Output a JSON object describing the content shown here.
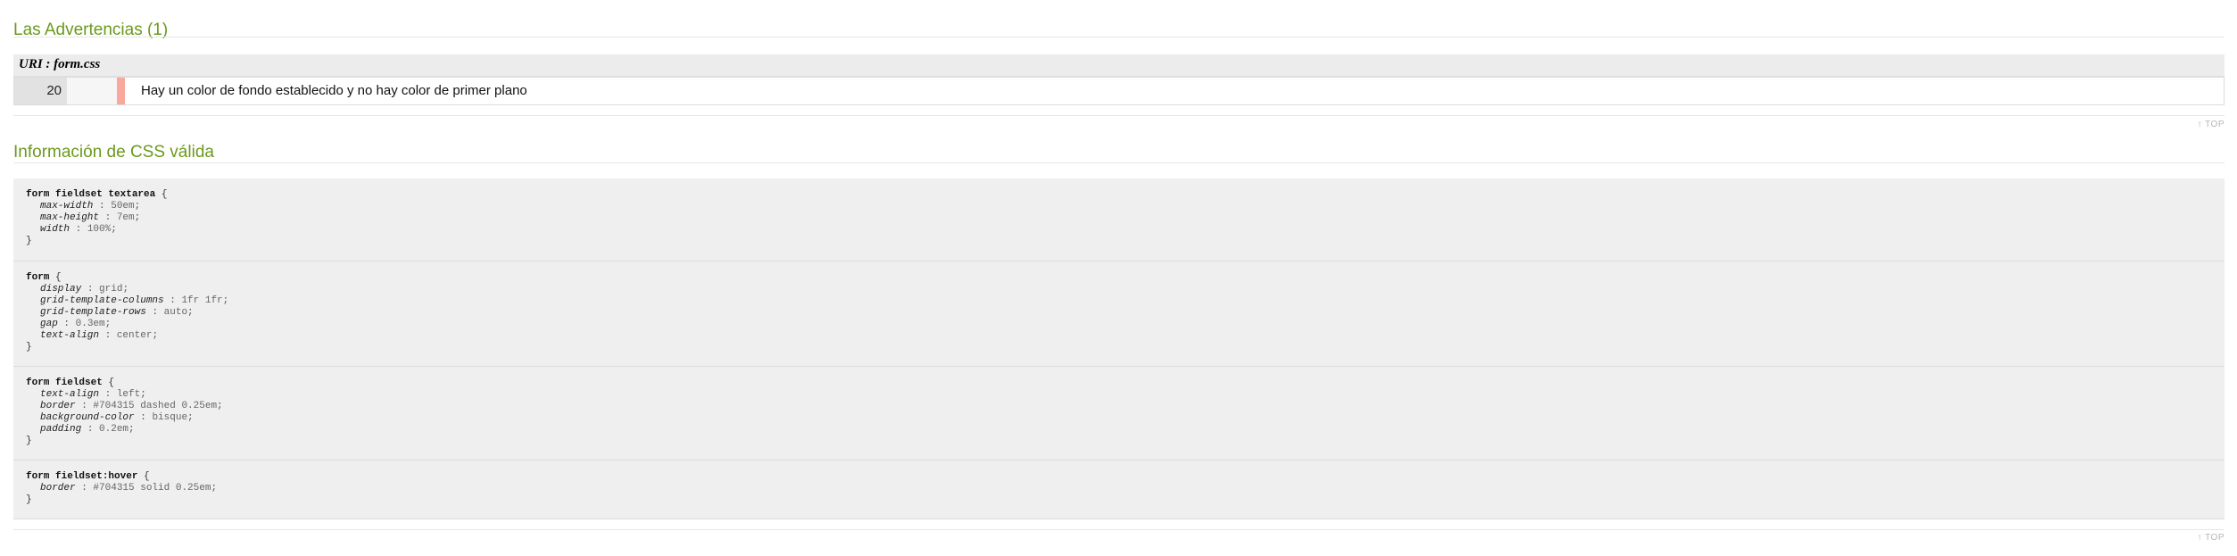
{
  "nav": {
    "top_label": "↑ TOP"
  },
  "warnings": {
    "title": "Las Advertencias (1)",
    "uri_label": "URI : form.css",
    "items": [
      {
        "line": "20",
        "message": "Hay un color de fondo establecido y no hay color de primer plano"
      }
    ]
  },
  "valid_css": {
    "title": "Información de CSS válida",
    "rules": [
      {
        "selector": "form fieldset textarea",
        "declarations": [
          {
            "property": "max-width",
            "value": "50em"
          },
          {
            "property": "max-height",
            "value": "7em"
          },
          {
            "property": "width",
            "value": "100%"
          }
        ]
      },
      {
        "selector": "form",
        "declarations": [
          {
            "property": "display",
            "value": "grid"
          },
          {
            "property": "grid-template-columns",
            "value": "1fr 1fr"
          },
          {
            "property": "grid-template-rows",
            "value": "auto"
          },
          {
            "property": "gap",
            "value": "0.3em"
          },
          {
            "property": "text-align",
            "value": "center"
          }
        ]
      },
      {
        "selector": "form fieldset",
        "declarations": [
          {
            "property": "text-align",
            "value": "left"
          },
          {
            "property": "border",
            "value": "#704315 dashed 0.25em"
          },
          {
            "property": "background-color",
            "value": "bisque"
          },
          {
            "property": "padding",
            "value": "0.2em"
          }
        ]
      },
      {
        "selector": "form fieldset:hover",
        "declarations": [
          {
            "property": "border",
            "value": "#704315 solid 0.25em"
          }
        ]
      }
    ]
  },
  "colors": {
    "heading": "#6a9a1c",
    "warning_marker": "#f9a89b",
    "block_background": "#efefef"
  }
}
